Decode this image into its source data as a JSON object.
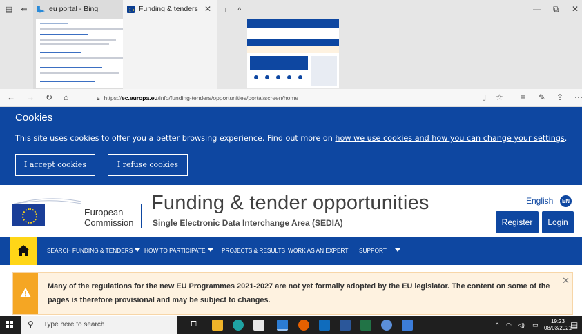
{
  "browser": {
    "tabs": [
      {
        "title": "eu portal - Bing"
      },
      {
        "title": "Funding & tenders"
      }
    ],
    "new_tab": "+",
    "tab_list": "^",
    "url_prefix": "https://",
    "url_host": "ec.europa.eu",
    "url_path": "/info/funding-tenders/opportunities/portal/screen/home"
  },
  "cookies": {
    "title": "Cookies",
    "text": "This site uses cookies to offer you a better browsing experience. Find out more on ",
    "link": "how we use cookies and how you can change your settings",
    "suffix": ".",
    "accept": "I accept cookies",
    "refuse": "I refuse cookies"
  },
  "header": {
    "org_line1": "European",
    "org_line2": "Commission",
    "title": "Funding & tender opportunities",
    "subtitle": "Single Electronic Data Interchange Area (SEDIA)",
    "language": "English",
    "language_code": "EN",
    "register": "Register",
    "login": "Login"
  },
  "nav": {
    "items": [
      {
        "label": "SEARCH FUNDING & TENDERS"
      },
      {
        "label": "HOW TO PARTICIPATE"
      },
      {
        "label": "PROJECTS & RESULTS"
      },
      {
        "label": "WORK AS AN EXPERT"
      },
      {
        "label": "SUPPORT"
      }
    ]
  },
  "notice": {
    "text": "Many of the regulations for the new EU Programmes 2021-2027 are not yet formally adopted by the EU legislator. The content on some of the pages is therefore provisional and may be subject to changes."
  },
  "taskbar": {
    "search_placeholder": "Type here to search",
    "time": "19:23",
    "date": "08/03/2021"
  },
  "colors": {
    "ec_blue": "#0e47a1",
    "ec_yellow": "#ffd617",
    "warning": "#f5a623"
  }
}
